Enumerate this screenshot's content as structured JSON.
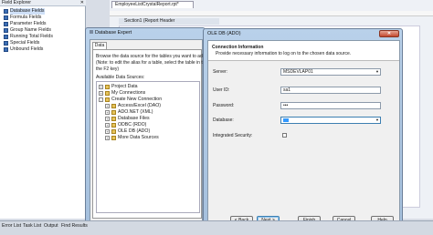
{
  "field_explorer": {
    "title": "Field Explorer",
    "items": [
      {
        "label": "Database Fields",
        "selected": true
      },
      {
        "label": "Formula Fields"
      },
      {
        "label": "Parameter Fields"
      },
      {
        "label": "Group Name Fields"
      },
      {
        "label": "Running Total Fields"
      },
      {
        "label": "Special Fields"
      },
      {
        "label": "Unbound Fields"
      }
    ]
  },
  "report": {
    "tab": "EmployeeListCrystalReport.rpt*",
    "section": "Section1 (Report Header"
  },
  "database_expert": {
    "title": "Database Expert",
    "tab": "Data",
    "desc_line1": "Browse the data source for the tables you want to add.",
    "desc_line2": "(Note: to edit the alias for a table, select the table in the",
    "desc_line3": "the F2 key)",
    "sources_label": "Available Data Sources:",
    "tree": [
      {
        "label": "Project Data",
        "expander": "+"
      },
      {
        "label": "My Connections",
        "expander": "+"
      },
      {
        "label": "Create New Connection",
        "expander": "-"
      },
      {
        "label": "Access/Excel (DAO)",
        "expander": "+"
      },
      {
        "label": "ADO.NET (XML)",
        "expander": "+"
      },
      {
        "label": "Database Files",
        "expander": "+"
      },
      {
        "label": "ODBC (RDO)",
        "expander": "+"
      },
      {
        "label": "OLE DB (ADO)",
        "expander": "+"
      },
      {
        "label": "More Data Sources",
        "expander": "+"
      }
    ]
  },
  "oledb": {
    "title": "OLE DB (ADO)",
    "heading": "Connection Information",
    "subheading": "Provide necessary information to log on to the chosen data source.",
    "server_label": "Server:",
    "server_value": "MSDEVLAP01",
    "userid_label": "User ID:",
    "userid_value": "sa1",
    "password_label": "Password:",
    "password_value": "•••",
    "database_label": "Database:",
    "database_value": "",
    "integrated_label": "Integrated Security:",
    "buttons": {
      "back": "< Back",
      "next": "Next >",
      "finish": "Finish",
      "cancel": "Cancel",
      "help": "Help"
    }
  },
  "bottom_tabs": [
    "Error List",
    "Task List",
    "Output",
    "Find Results"
  ]
}
